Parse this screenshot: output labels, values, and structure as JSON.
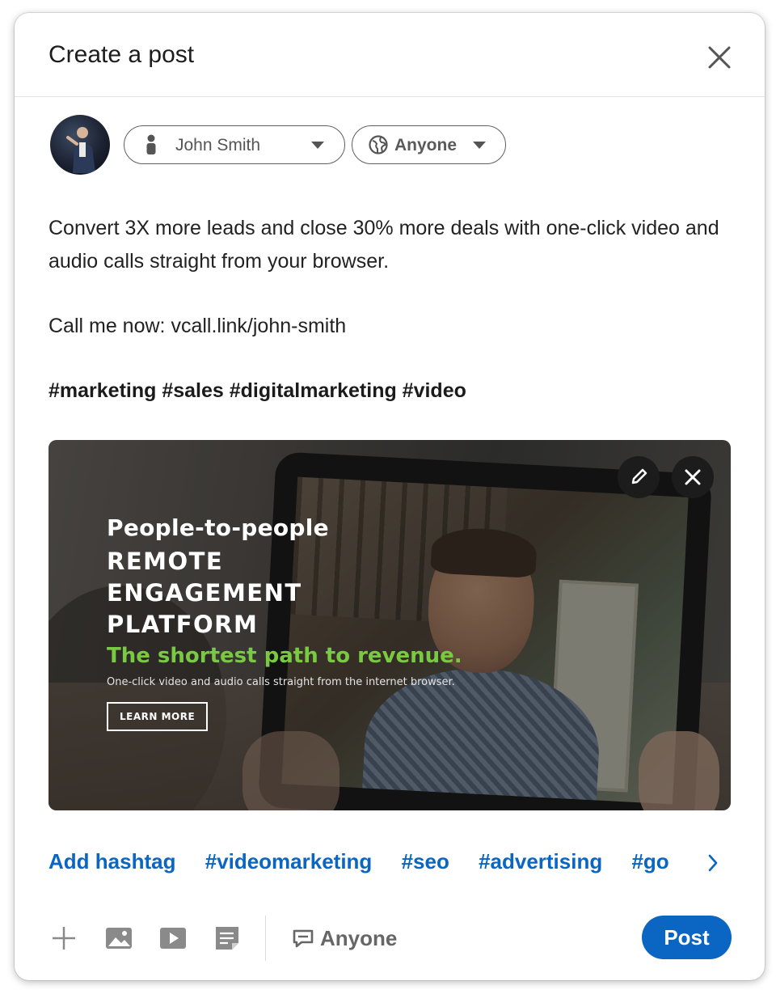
{
  "dialog": {
    "title": "Create a post"
  },
  "author": {
    "name": "John Smith"
  },
  "visibility": {
    "label": "Anyone"
  },
  "post": {
    "line1": "Convert 3X more leads and close 30% more deals with one-click video and audio calls straight from your browser.",
    "line2": "Call me now: vcall.link/john-smith",
    "tags": "#marketing #sales #digitalmarketing #video"
  },
  "media": {
    "ad_sub": "People-to-people",
    "ad_head_1": "REMOTE",
    "ad_head_2": "ENGAGEMENT",
    "ad_head_3": "PLATFORM",
    "ad_tagline": "The shortest path to revenue.",
    "ad_small": "One-click video and audio calls straight from the internet browser.",
    "ad_button": "LEARN MORE",
    "green": "#7ac943"
  },
  "hashtag_bar": {
    "items": [
      "Add hashtag",
      "#videomarketing",
      "#seo",
      "#advertising",
      "#go"
    ],
    "color": "#0a66c2"
  },
  "toolbar": {
    "icons": [
      "plus-icon",
      "photo-icon",
      "video-icon",
      "document-icon"
    ],
    "comment_visibility": "Anyone",
    "post_label": "Post",
    "accent": "#0a66c2"
  }
}
